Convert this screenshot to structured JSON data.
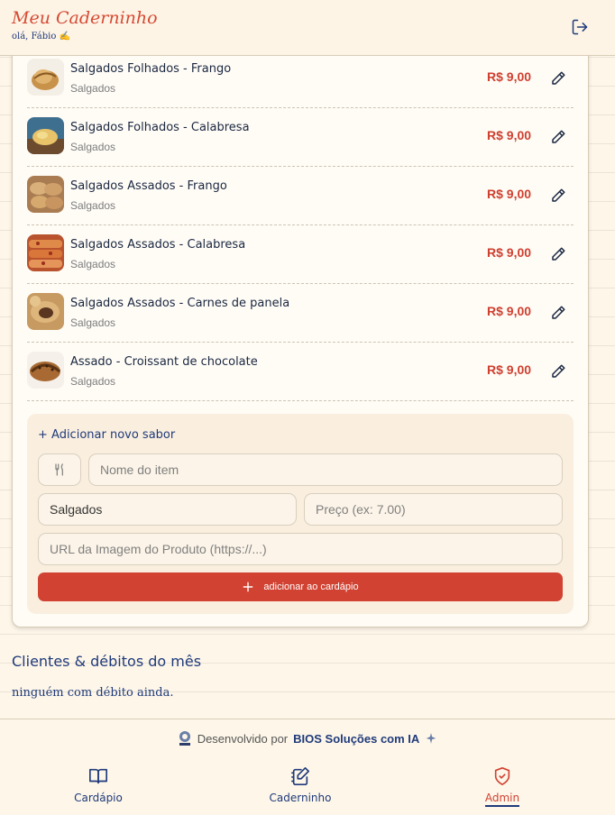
{
  "header": {
    "app_title": "Meu Caderninho",
    "greeting": "olá, Fábio ✍"
  },
  "menu": {
    "items": [
      {
        "name": "Salgados Folhados - Frango",
        "category": "Salgados",
        "price": "R$ 9,00"
      },
      {
        "name": "Salgados Folhados - Calabresa",
        "category": "Salgados",
        "price": "R$ 9,00"
      },
      {
        "name": "Salgados Assados - Frango",
        "category": "Salgados",
        "price": "R$ 9,00"
      },
      {
        "name": "Salgados Assados - Calabresa",
        "category": "Salgados",
        "price": "R$ 9,00"
      },
      {
        "name": "Salgados Assados - Carnes de panela",
        "category": "Salgados",
        "price": "R$ 9,00"
      },
      {
        "name": "Assado - Croissant de chocolate",
        "category": "Salgados",
        "price": "R$ 9,00"
      }
    ]
  },
  "add_form": {
    "title": "+ Adicionar novo sabor",
    "name_placeholder": "Nome do item",
    "category_value": "Salgados",
    "price_placeholder": "Preço (ex: 7.00)",
    "image_placeholder": "URL da Imagem do Produto (https://...)",
    "submit_label": "adicionar ao cardápio"
  },
  "clients": {
    "title": "Clientes & débitos do mês",
    "empty_message": "ninguém com débito ainda."
  },
  "footer": {
    "credit_prefix": "Desenvolvido por",
    "credit_brand": "BIOS Soluções com IA"
  },
  "bottom_nav": {
    "items": [
      {
        "label": "Cardápio",
        "icon": "book-icon"
      },
      {
        "label": "Caderninho",
        "icon": "notebook-edit-icon"
      },
      {
        "label": "Admin",
        "icon": "shield-check-icon",
        "active": true
      }
    ]
  },
  "colors": {
    "accent_red": "#d14232",
    "navy": "#1f3a7a",
    "price_red": "#cf3f2f"
  }
}
